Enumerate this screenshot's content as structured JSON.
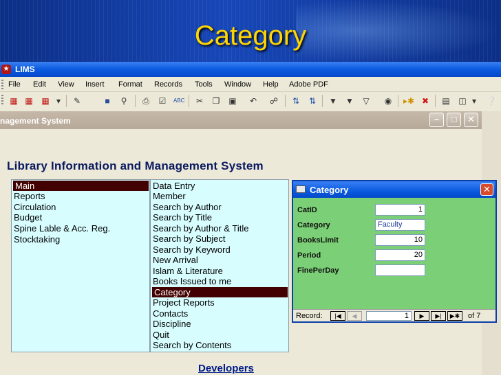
{
  "slide": {
    "title": "Category"
  },
  "app": {
    "title": "LIMS",
    "menu": [
      "File",
      "Edit",
      "View",
      "Insert",
      "Format",
      "Records",
      "Tools",
      "Window",
      "Help",
      "Adobe PDF"
    ],
    "toolbar_icons": [
      "pdf-convert-icon",
      "pdf-email-icon",
      "pdf-review-icon",
      "dropdown-icon",
      "design-view-icon",
      "save-icon",
      "search-icon",
      "print-icon",
      "print-preview-icon",
      "spelling-icon",
      "cut-icon",
      "copy-icon",
      "paste-icon",
      "undo-icon",
      "insert-hyperlink-icon",
      "sort-ascending-icon",
      "sort-descending-icon",
      "filter-by-selection-icon",
      "filter-by-form-icon",
      "apply-filter-icon",
      "find-icon",
      "new-record-icon",
      "delete-record-icon",
      "properties-icon",
      "database-window-icon",
      "new-object-icon",
      "help-icon"
    ]
  },
  "main_form": {
    "title": "nagement System",
    "heading": "Library Information and Management System",
    "left_menu": [
      "Main",
      "Reports",
      "Circulation",
      "Budget",
      "Spine Lable & Acc. Reg.",
      "Stocktaking"
    ],
    "left_selected_index": 0,
    "right_menu": [
      "Data Entry",
      "Member",
      "Search by Author",
      "Search by Title",
      "Search by Author & Title",
      "Search by Subject",
      "Search by Keyword",
      "New Arrival",
      "Islam & Literature",
      "Books Issued to me",
      "Category",
      "Project Reports",
      "Contacts",
      "Discipline",
      "Quit",
      "Search by Contents"
    ],
    "right_selected_index": 10,
    "developers_link": "Developers"
  },
  "category_form": {
    "title": "Category",
    "fields": [
      {
        "label": "CatID",
        "value": "1"
      },
      {
        "label": "Category",
        "value": "Faculty"
      },
      {
        "label": "BooksLimit",
        "value": "10"
      },
      {
        "label": "Period",
        "value": "20"
      },
      {
        "label": "FinePerDay",
        "value": ""
      }
    ],
    "record_nav": {
      "label": "Record:",
      "current": "1",
      "of_text": "of  7"
    }
  },
  "colors": {
    "slide_title": "#ffd600",
    "list_background": "#d7fdff",
    "list_selection": "#420000",
    "dialog_background": "#7bcf76",
    "heading": "#0a1a60",
    "link": "#001b8a"
  }
}
